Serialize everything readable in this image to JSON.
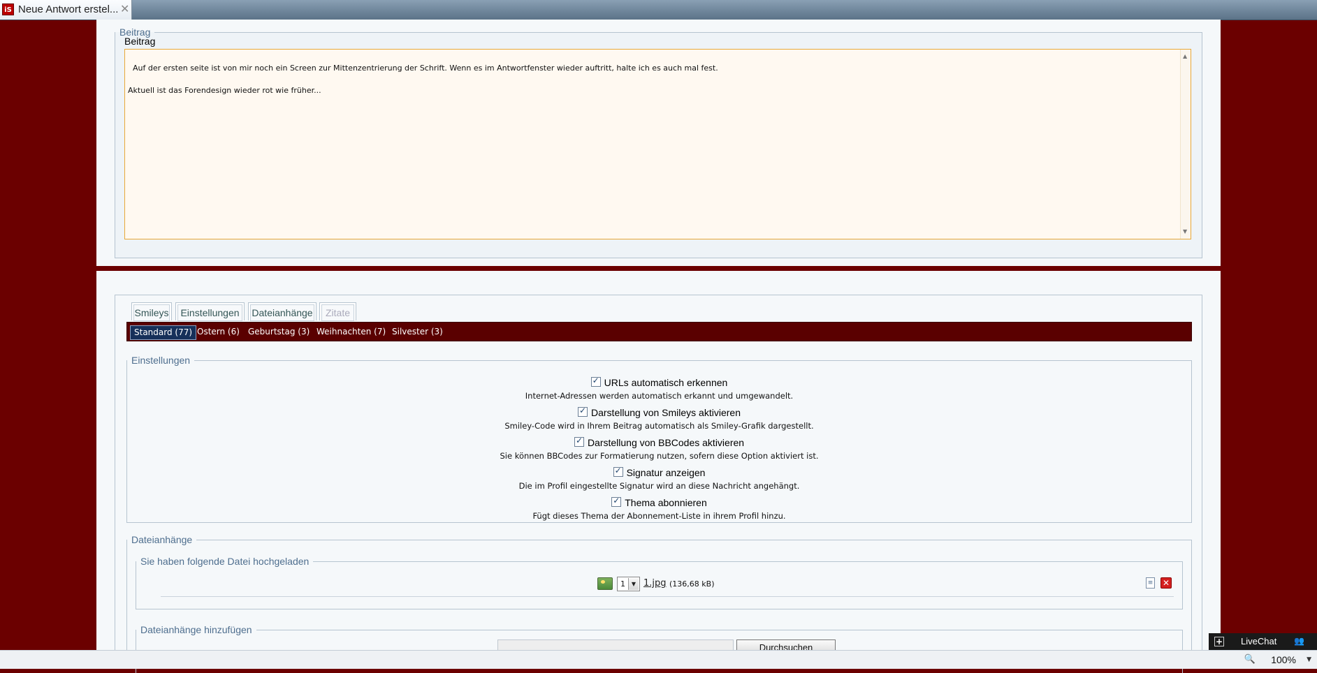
{
  "browser": {
    "tab_title": "Neue Antwort erstel...",
    "favicon_text": "iS",
    "zoom": "100%"
  },
  "beitrag": {
    "legend": "Beitrag",
    "label": "Beitrag",
    "text": "Auf der ersten seite ist von mir noch ein Screen zur Mittenzentrierung der Schrift. Wenn es im Antwortfenster wieder auftritt, halte ich es auch mal fest.\n\nAktuell ist das Forendesign wieder rot wie früher..."
  },
  "tabs": [
    "Smileys",
    "Einstellungen",
    "Dateianhänge",
    "Zitate"
  ],
  "smiley_categories": [
    "Standard (77)",
    "Ostern (6)",
    "Geburtstag (3)",
    "Weihnachten (7)",
    "Silvester (3)"
  ],
  "einstellungen": {
    "legend": "Einstellungen",
    "options": [
      {
        "label": "URLs automatisch erkennen",
        "desc": "Internet-Adressen werden automatisch erkannt und umgewandelt.",
        "checked": true
      },
      {
        "label": "Darstellung von Smileys aktivieren",
        "desc": "Smiley-Code wird in Ihrem Beitrag automatisch als Smiley-Grafik dargestellt.",
        "checked": true
      },
      {
        "label": "Darstellung von BBCodes aktivieren",
        "desc": "Sie können BBCodes zur Formatierung nutzen, sofern diese Option aktiviert ist.",
        "checked": true
      },
      {
        "label": "Signatur anzeigen",
        "desc": "Die im Profil eingestellte Signatur wird an diese Nachricht angehängt.",
        "checked": true
      },
      {
        "label": "Thema abonnieren",
        "desc": "Fügt dieses Thema der Abonnement-Liste in ihrem Profil hinzu.",
        "checked": true
      }
    ]
  },
  "dateianhaenge": {
    "legend": "Dateianhänge",
    "uploaded_legend": "Sie haben folgende Datei hochgeladen",
    "file": {
      "position": "1",
      "name": "1.jpg",
      "size": "(136,68 kB)"
    },
    "add_legend": "Dateianhänge hinzufügen",
    "browse_label": "Durchsuchen"
  },
  "livechat": {
    "label": "LiveChat"
  },
  "colors": {
    "page_bg": "#6b0000",
    "smiley_bar": "#5a0000",
    "active_cat": "#16305a",
    "textarea_border": "#e8a838"
  }
}
